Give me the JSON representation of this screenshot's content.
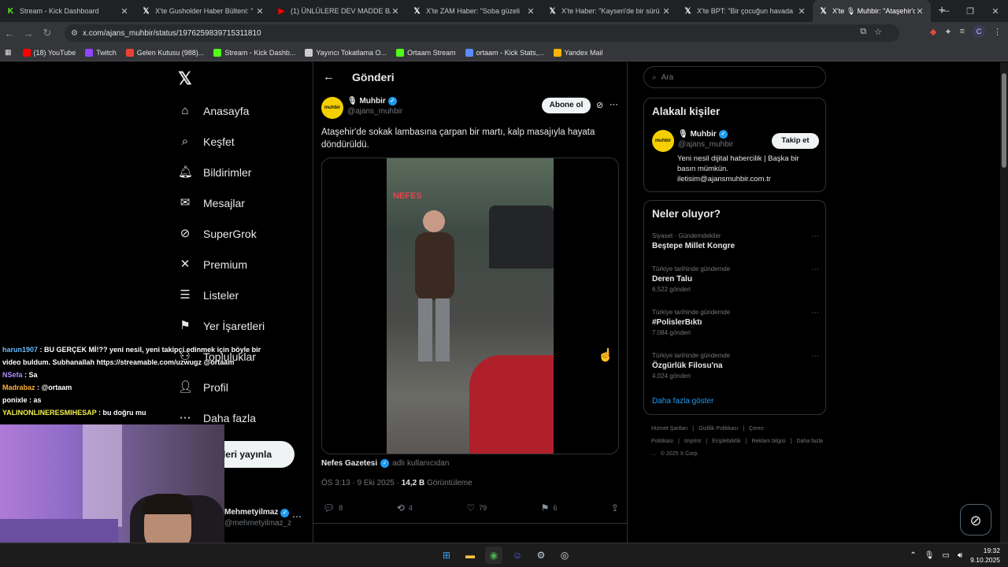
{
  "browser": {
    "tabs": [
      {
        "title": "Stream - Kick Dashboard",
        "icon": "kick-icon",
        "color": "#53fc18"
      },
      {
        "title": "X'te Gusholder Haber Bülteni: \"",
        "icon": "x-icon",
        "color": "#ffffff"
      },
      {
        "title": "(1) ÜNLÜLERE DEV MADDE BA",
        "icon": "youtube-icon",
        "color": "#ff0000"
      },
      {
        "title": "X'te ZAM Haber: \"Soba güzeli",
        "icon": "x-icon",
        "color": "#ffffff"
      },
      {
        "title": "X'te Haber: \"Kayseri'de bir sürü",
        "icon": "x-icon",
        "color": "#ffffff"
      },
      {
        "title": "X'te BPT: \"Bir çocuğun havada",
        "icon": "x-icon",
        "color": "#ffffff"
      },
      {
        "title": "X'te 🎙 Muhbir: \"Ataşehir'd",
        "icon": "x-icon",
        "color": "#ffffff",
        "active": true
      }
    ],
    "url": "x.com/ajans_muhbir/status/1976259839715311810",
    "profile_letter": "C",
    "bookmarks": [
      {
        "label": "(18) YouTube",
        "icon": "youtube-icon",
        "color": "#ff0000"
      },
      {
        "label": "Twitch",
        "icon": "twitch-icon",
        "color": "#9146ff"
      },
      {
        "label": "Gelen Kutusu (988)...",
        "icon": "mail-icon",
        "color": "#ea4335"
      },
      {
        "label": "Stream - Kick Dashb...",
        "icon": "kick-icon",
        "color": "#53fc18"
      },
      {
        "label": "Yayıncı Tokatlama O...",
        "icon": "globe-icon",
        "color": "#cccccc"
      },
      {
        "label": "Ortaam Stream",
        "icon": "kick-icon",
        "color": "#53fc18"
      },
      {
        "label": "ortaam - Kick Stats,...",
        "icon": "stats-icon",
        "color": "#5b8cff"
      },
      {
        "label": "Yandex Mail",
        "icon": "mail-icon",
        "color": "#ffb300"
      }
    ]
  },
  "nav": {
    "items": [
      {
        "label": "Anasayfa",
        "icon": "home-icon",
        "glyph": "⌂"
      },
      {
        "label": "Keşfet",
        "icon": "search-icon",
        "glyph": "⌕"
      },
      {
        "label": "Bildirimler",
        "icon": "bell-icon",
        "glyph": "🔔︎"
      },
      {
        "label": "Mesajlar",
        "icon": "mail-icon",
        "glyph": "✉"
      },
      {
        "label": "SuperGrok",
        "icon": "grok-icon",
        "glyph": "⊘"
      },
      {
        "label": "Premium",
        "icon": "x-icon",
        "glyph": "✕"
      },
      {
        "label": "Listeler",
        "icon": "list-icon",
        "glyph": "☰"
      },
      {
        "label": "Yer İşaretleri",
        "icon": "bookmark-icon",
        "glyph": "⚑"
      },
      {
        "label": "Topluluklar",
        "icon": "communities-icon",
        "glyph": "⚇"
      },
      {
        "label": "Profil",
        "icon": "profile-icon",
        "glyph": "👤︎"
      },
      {
        "label": "Daha fazla",
        "icon": "more-circle-icon",
        "glyph": "⋯"
      }
    ],
    "post_button": "Gönderi yayınla",
    "me_name": "Mehmetyilmaz",
    "me_handle": "@mehmetyilmaz_z"
  },
  "post": {
    "header": "Gönderi",
    "author_name": "🎙 Muhbir",
    "author_handle": "@ajans_muhbir",
    "avatar_text": "muhbir",
    "subscribe": "Abone ol",
    "text": "Ataşehir'de sokak lambasına çarpan bir martı, kalp masajıyla hayata döndürüldü.",
    "video_label": "NEFES",
    "source_name": "Nefes Gazetesi",
    "source_via": "adlı kullanıcıdan",
    "time": "ÖS 3:13 · 9 Eki 2025 · ",
    "views": "14,2 B",
    "views_label": " Görüntüleme",
    "replies": "8",
    "reposts": "4",
    "likes": "79",
    "bookmarks": "6"
  },
  "sidebar": {
    "search_placeholder": "Ara",
    "related_title": "Alakalı kişiler",
    "related": {
      "name": "🎙 Muhbir",
      "handle": "@ajans_muhbir",
      "follow": "Takip et",
      "bio": "Yeni nesil dijital habercilik | Başka bir basın mümkün. iletisim@ajansmuhbir.com.tr"
    },
    "trends_title": "Neler oluyor?",
    "trends": [
      {
        "category": "Siyaset · Gündemdekiler",
        "name": "Beştepe Millet Kongre",
        "count": ""
      },
      {
        "category": "Türkiye tarihinde gündemde",
        "name": "Deren Talu",
        "count": "6.522 gönderi"
      },
      {
        "category": "Türkiye tarihinde gündemde",
        "name": "#PolislerBıktı",
        "count": "7.084 gönderi"
      },
      {
        "category": "Türkiye tarihinde gündemde",
        "name": "Özgürlük Filosu'na",
        "count": "4.024 gönderi"
      }
    ],
    "show_more": "Daha fazla göster",
    "footer": [
      "Hizmet Şartları",
      "|",
      "Gizlilik Politikası",
      "|",
      "Çerez Politikası",
      "|",
      "Imprint",
      "|",
      "Erişilebilirlik",
      "|",
      "Reklam bilgisi",
      "|",
      "Daha fazla ...",
      "© 2025 X Corp."
    ]
  },
  "chat": [
    {
      "user": "harun1907",
      "msg": " : BU GERÇEK Mİ!?? yeni nesil, yeni takipçi edinmek için böyle bir video buldum. Subhanallah https://streamable.com/uzwugz @ortaam",
      "cls": "u1"
    },
    {
      "user": "NSefa",
      "msg": " : Sa",
      "cls": "u2"
    },
    {
      "user": "Madrabaz",
      "msg": " : @ortaam",
      "cls": "u3"
    },
    {
      "user": "ponixle",
      "msg": " : as",
      "cls": "u4"
    },
    {
      "user": "YALINONLINERESMIHESAP",
      "msg": " : bu doğru mu",
      "cls": "u5"
    }
  ],
  "taskbar": {
    "time": "19:32",
    "date": "9.10.2025"
  }
}
